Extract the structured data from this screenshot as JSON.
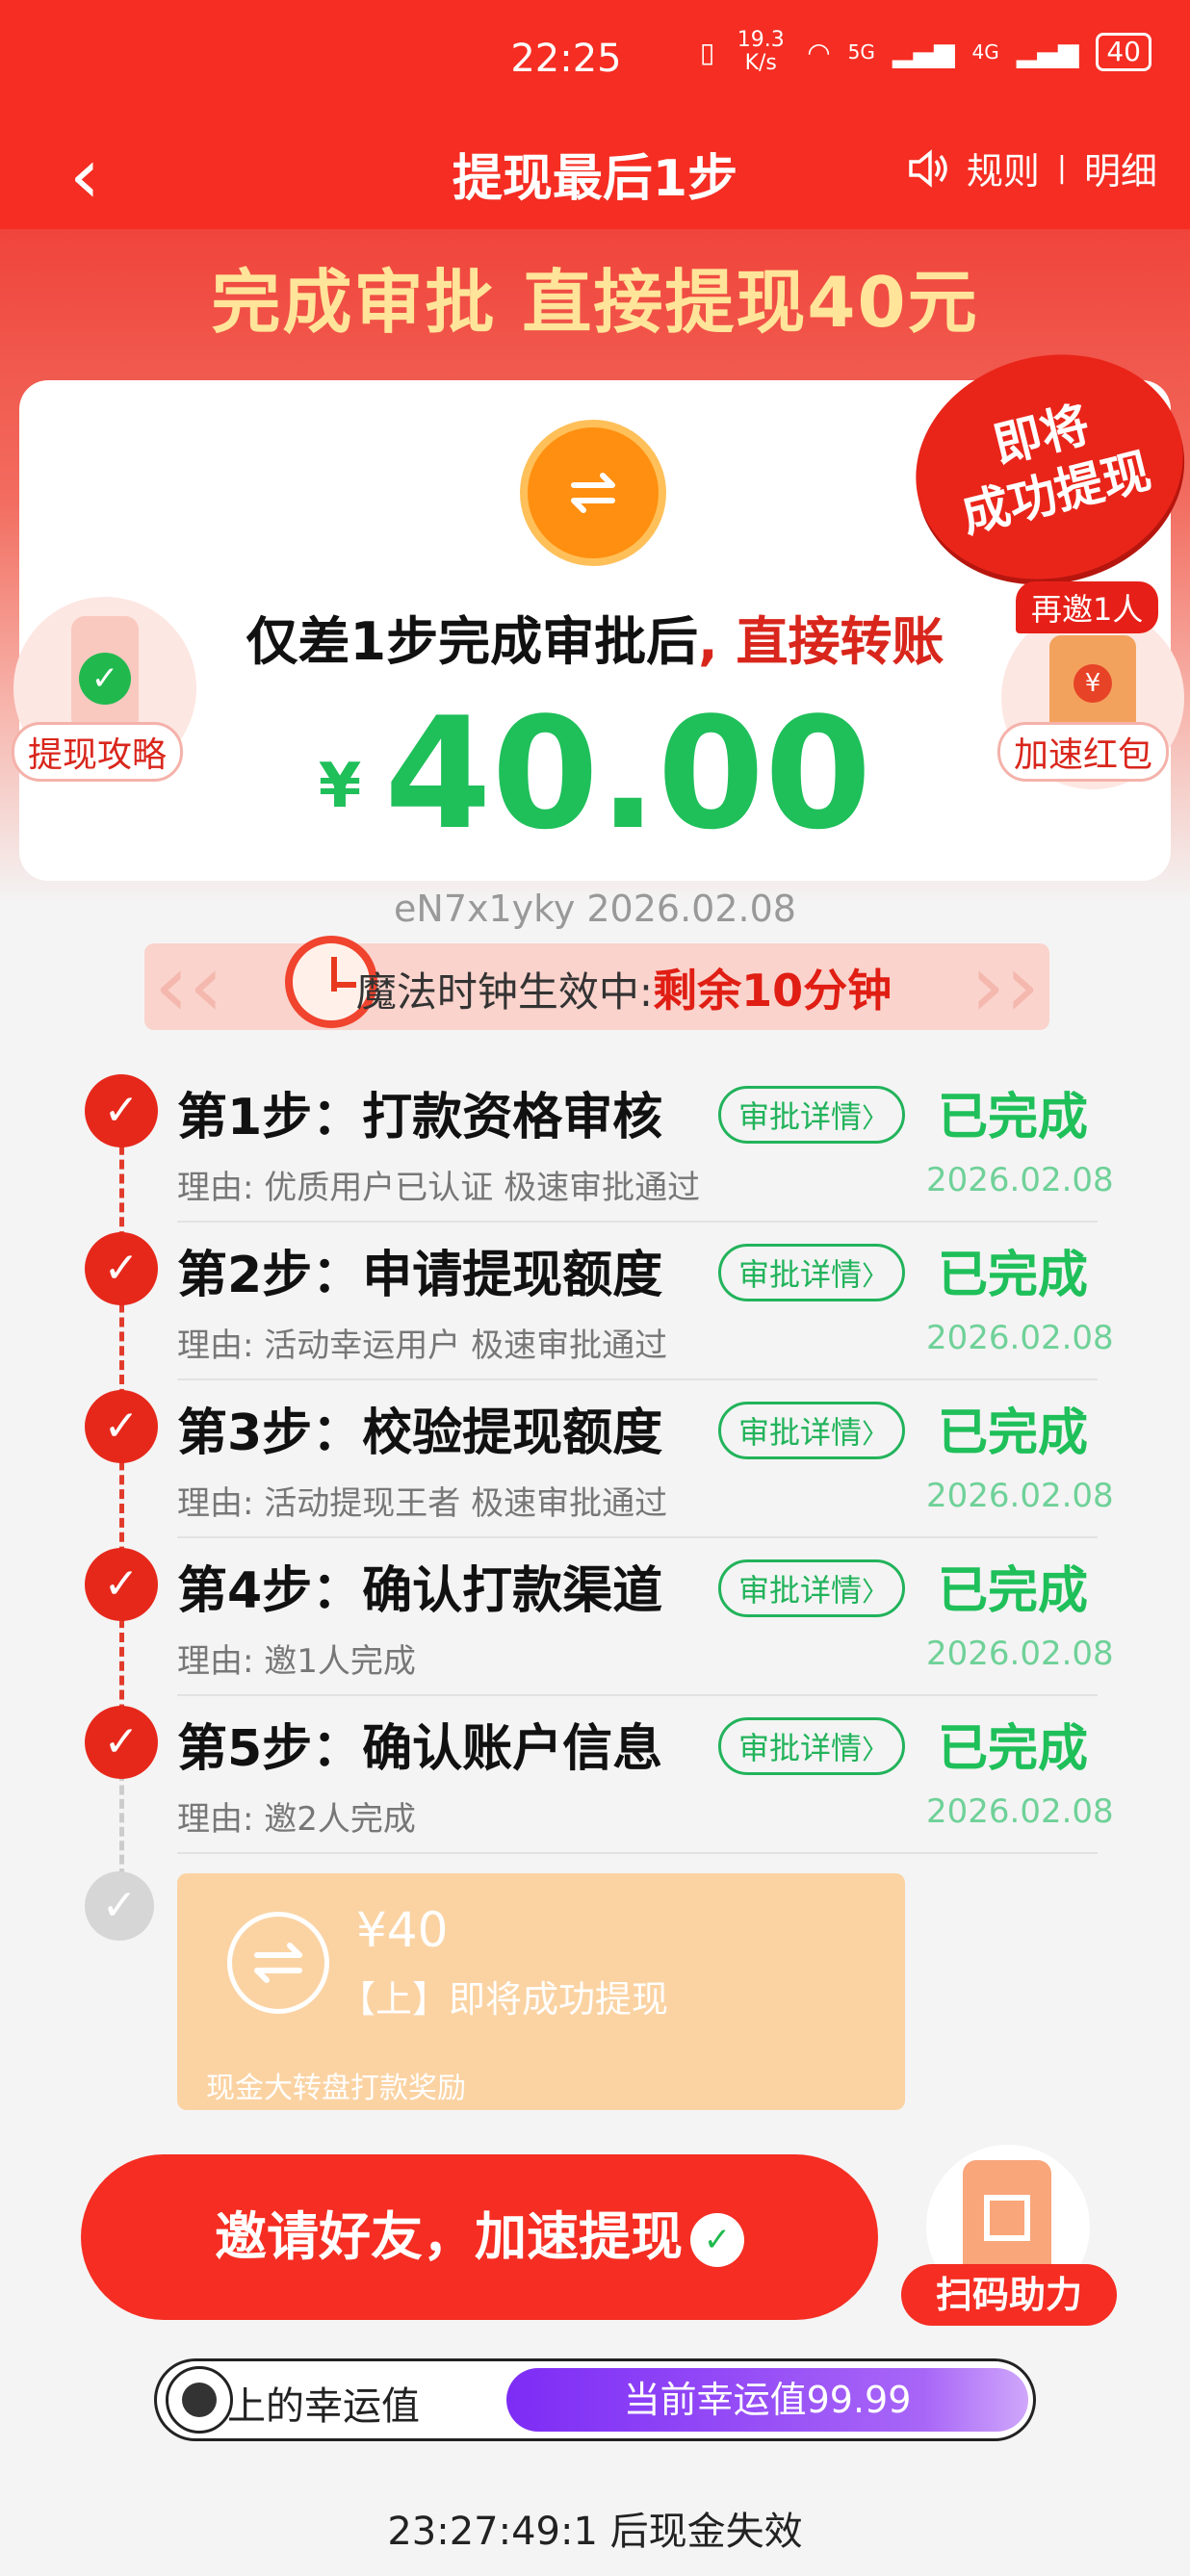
{
  "status": {
    "time": "22:25",
    "speed": "19.3 K/s",
    "net1": "5G",
    "net2": "4G",
    "battery": "40"
  },
  "nav": {
    "title": "提现最后1步",
    "rules": "规则",
    "sep": "|",
    "details": "明细"
  },
  "hero": {
    "headline": "完成审批 直接提现40元",
    "seal_line1": "即将",
    "seal_line2": "成功提现",
    "card_prefix": "仅差1步完成审批后",
    "card_suffix": ", 直接转账",
    "currency": "¥",
    "amount": "40.00",
    "left_label": "提现攻略",
    "right_tag": "再邀1人",
    "right_label": "加速红包",
    "serial": "eN7x1yky 2026.02.08"
  },
  "banner": {
    "prefix": "魔法时钟生效中:",
    "highlight": "剩余10分钟"
  },
  "steps": [
    {
      "title": "第1步：打款资格审核",
      "detail": "审批详情",
      "status": "已完成",
      "reason": "理由: 优质用户已认证 极速审批通过",
      "date": "2026.02.08"
    },
    {
      "title": "第2步：申请提现额度",
      "detail": "审批详情",
      "status": "已完成",
      "reason": "理由: 活动幸运用户 极速审批通过",
      "date": "2026.02.08"
    },
    {
      "title": "第3步：校验提现额度",
      "detail": "审批详情",
      "status": "已完成",
      "reason": "理由: 活动提现王者 极速审批通过",
      "date": "2026.02.08"
    },
    {
      "title": "第4步：确认打款渠道",
      "detail": "审批详情",
      "status": "已完成",
      "reason": "理由: 邀1人完成",
      "date": "2026.02.08"
    },
    {
      "title": "第5步：确认账户信息",
      "detail": "审批详情",
      "status": "已完成",
      "reason": "理由: 邀2人完成",
      "date": "2026.02.08"
    }
  ],
  "pending": {
    "amount": "¥40",
    "text": "【上】即将成功提现",
    "footer": "现金大转盘打款奖励"
  },
  "cta": {
    "label": "邀请好友，加速提现",
    "scan_label": "扫码助力"
  },
  "luck": {
    "label": "上的幸运值",
    "value_text": "当前幸运值99.99"
  },
  "countdown": "23:27:49:1 后现金失效",
  "colors": {
    "primary_red": "#f52d22",
    "success_green": "#1fbf5a",
    "luck_purple": "#7d2cf5",
    "pending_orange": "#fbd3a3"
  }
}
